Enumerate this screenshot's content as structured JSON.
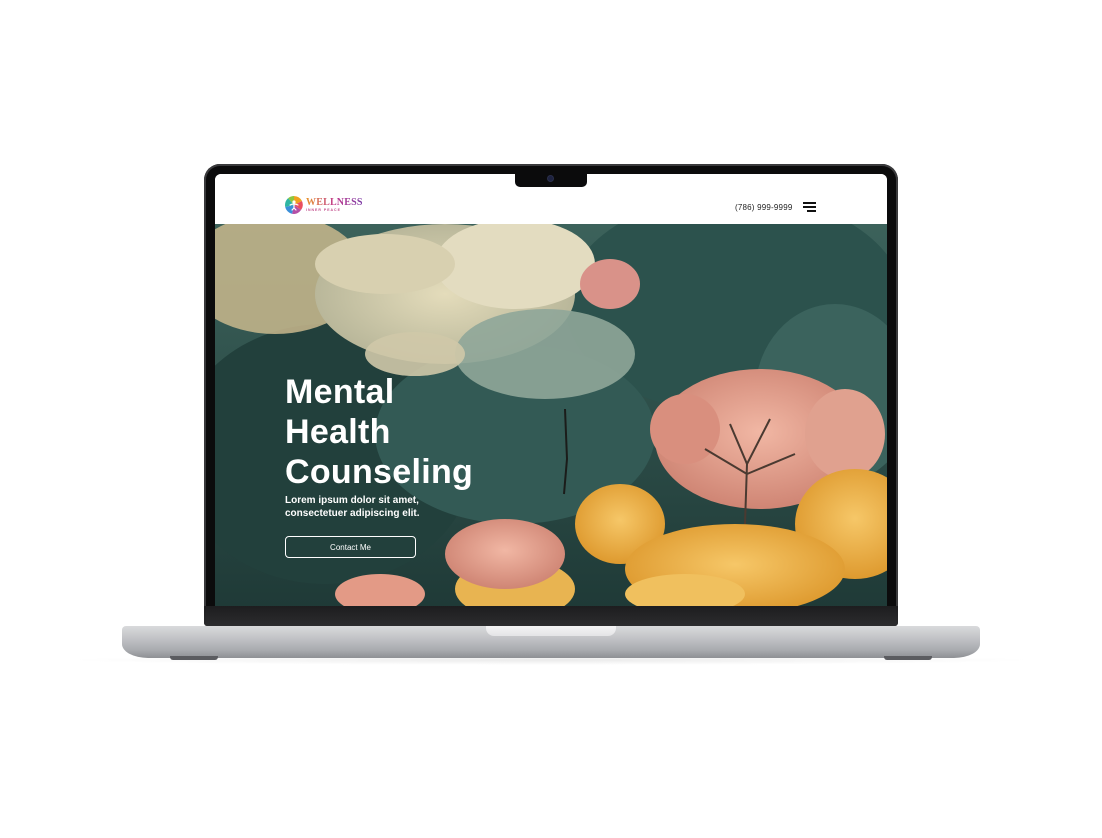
{
  "header": {
    "logo_name": "WELLNESS",
    "logo_tagline": "INNER PEACE",
    "phone": "(786) 999-9999",
    "menu_icon": "hamburger-menu-icon"
  },
  "hero": {
    "title_lines": [
      "Mental",
      "Health",
      "Counseling"
    ],
    "subtitle_line1": "Lorem ipsum dolor sit amet,",
    "subtitle_line2": "consectetuer adipiscing elit.",
    "cta_label": "Contact Me"
  },
  "colors": {
    "hero_bg": "#2d4e4a",
    "cloud": "#d9d2b0",
    "blossom_pink": "#e3a08f",
    "blossom_yellow": "#efb347",
    "text_light": "#ffffff"
  }
}
